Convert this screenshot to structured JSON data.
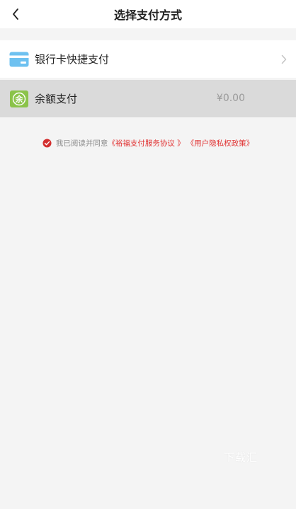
{
  "header": {
    "title": "选择支付方式"
  },
  "payment_methods": [
    {
      "label": "银行卡快捷支付",
      "icon": "bank-card-icon"
    },
    {
      "label": "余额支付",
      "amount": "¥0.00",
      "icon": "balance-icon",
      "icon_glyph": "余"
    }
  ],
  "agreement": {
    "prefix": "我已阅读并同意",
    "service_link": "《裕福支付服务协议 》",
    "privacy_link": "《用户隐私权政策》",
    "checked": true
  },
  "watermark": "下载汇",
  "colors": {
    "link": "#e13131",
    "check": "#d32f2f",
    "balance_icon": "#8bc34a",
    "card_icon": "#6ec1f0",
    "selected_row": "#dadada"
  }
}
